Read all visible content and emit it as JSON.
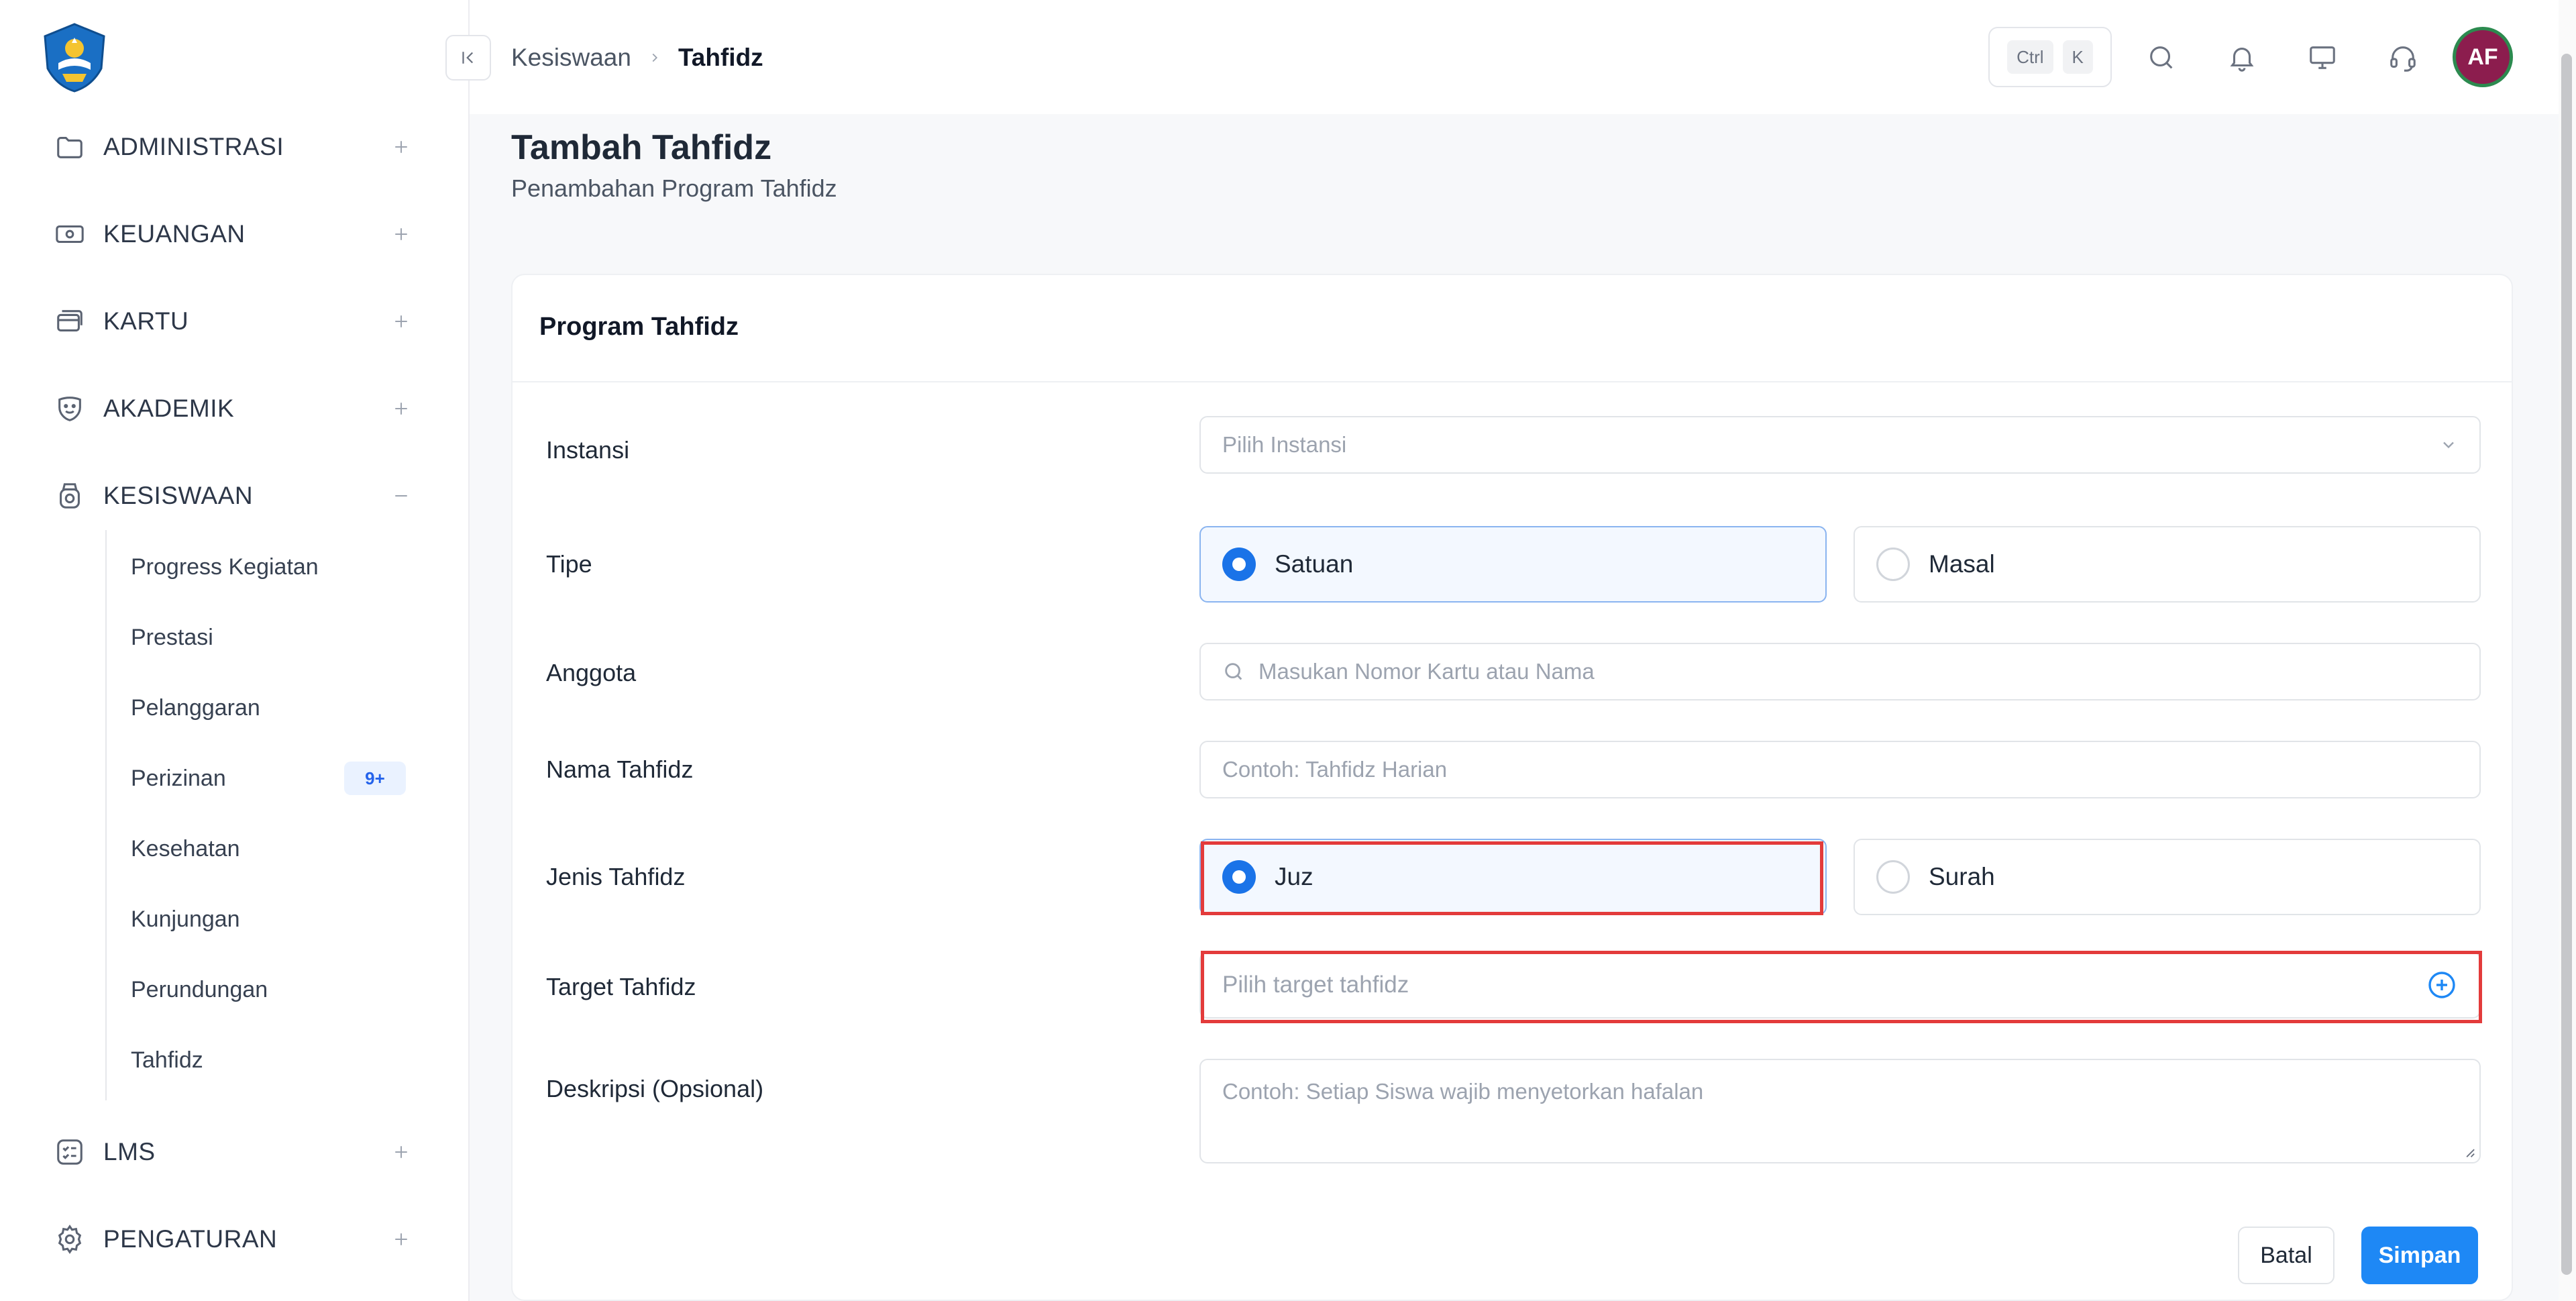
{
  "sidebar": {
    "menu": [
      {
        "label": "ADMINISTRASI",
        "icon": "folder-icon",
        "toggle": "+"
      },
      {
        "label": "KEUANGAN",
        "icon": "money-icon",
        "toggle": "+"
      },
      {
        "label": "KARTU",
        "icon": "card-icon",
        "toggle": "+"
      },
      {
        "label": "AKADEMIK",
        "icon": "mask-icon",
        "toggle": "+"
      },
      {
        "label": "KESISWAAN",
        "icon": "student-icon",
        "toggle": "−"
      },
      {
        "label": "LMS",
        "icon": "checklist-icon",
        "toggle": "+"
      },
      {
        "label": "PENGATURAN",
        "icon": "gear-icon",
        "toggle": "+"
      }
    ],
    "kesiswaan_items": [
      {
        "label": "Progress Kegiatan"
      },
      {
        "label": "Prestasi"
      },
      {
        "label": "Pelanggaran"
      },
      {
        "label": "Perizinan",
        "badge": "9+"
      },
      {
        "label": "Kesehatan"
      },
      {
        "label": "Kunjungan"
      },
      {
        "label": "Perundungan"
      },
      {
        "label": "Tahfidz"
      }
    ]
  },
  "topbar": {
    "breadcrumb": {
      "parent": "Kesiswaan",
      "current": "Tahfidz"
    },
    "shortcut": {
      "key1": "Ctrl",
      "key2": "K"
    },
    "avatar_initials": "AF"
  },
  "page": {
    "title": "Tambah Tahfidz",
    "subtitle": "Penambahan Program Tahfidz"
  },
  "form": {
    "card_title": "Program Tahfidz",
    "instansi": {
      "label": "Instansi",
      "placeholder": "Pilih Instansi"
    },
    "tipe": {
      "label": "Tipe",
      "options": [
        "Satuan",
        "Masal"
      ],
      "selected": "Satuan"
    },
    "anggota": {
      "label": "Anggota",
      "placeholder": "Masukan Nomor Kartu atau Nama"
    },
    "nama": {
      "label": "Nama Tahfidz",
      "placeholder": "Contoh: Tahfidz Harian"
    },
    "jenis": {
      "label": "Jenis Tahfidz",
      "options": [
        "Juz",
        "Surah"
      ],
      "selected": "Juz"
    },
    "target": {
      "label": "Target Tahfidz",
      "placeholder": "Pilih target tahfidz"
    },
    "deskripsi": {
      "label": "Deskripsi (Opsional)",
      "placeholder": "Contoh: Setiap Siswa wajib menyetorkan hafalan"
    },
    "buttons": {
      "cancel": "Batal",
      "save": "Simpan"
    }
  },
  "colors": {
    "accent": "#1e88f5",
    "highlight": "#e33b3b",
    "avatar_bg": "#8c1d4e"
  }
}
